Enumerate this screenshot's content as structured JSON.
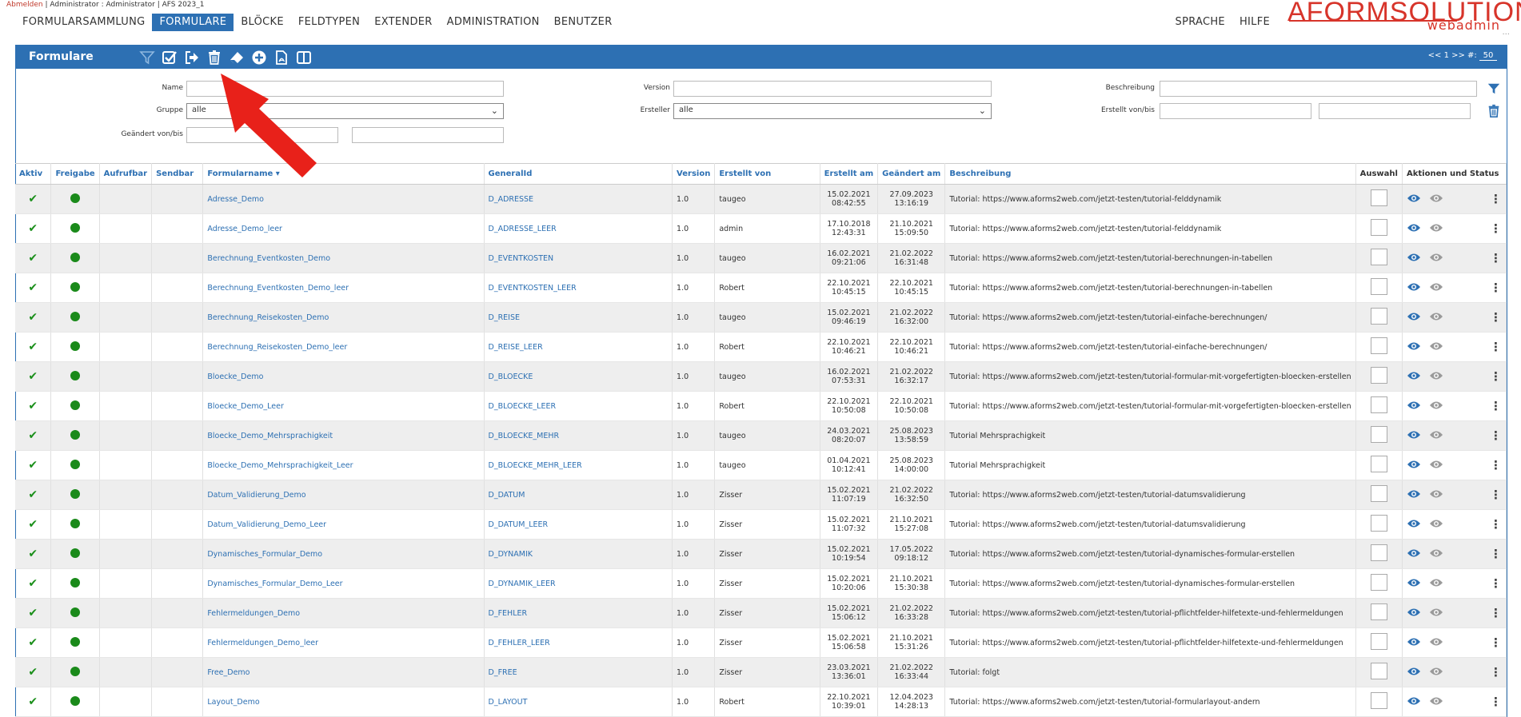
{
  "topline": {
    "logout": "Abmelden",
    "info": " | Administrator : Administrator | AFS 2023_1"
  },
  "nav": {
    "items": [
      "FORMULARSAMMLUNG",
      "FORMULARE",
      "BLÖCKE",
      "FELDTYPEN",
      "EXTENDER",
      "ADMINISTRATION",
      "BENUTZER"
    ],
    "active": "FORMULARE",
    "right": [
      "SPRACHE",
      "HILFE"
    ]
  },
  "logo": {
    "main": "AFORMSOLUTION",
    "sub": "webadmin"
  },
  "panel": {
    "title": "Formulare",
    "pager_text": "<< 1 >>  #:",
    "page_size": "50"
  },
  "toolbar_icons": [
    "filter-icon",
    "check-all-icon",
    "export-icon",
    "delete-icon",
    "eraser-icon",
    "add-icon",
    "pdf-icon",
    "columns-icon"
  ],
  "filters": {
    "name_label": "Name",
    "version_label": "Version",
    "beschreibung_label": "Beschreibung",
    "gruppe_label": "Gruppe",
    "gruppe_value": "alle",
    "ersteller_label": "Ersteller",
    "ersteller_value": "alle",
    "erstellt_label": "Erstellt von/bis",
    "geaendert_label": "Geändert von/bis"
  },
  "table": {
    "headers": {
      "aktiv": "Aktiv",
      "freigabe": "Freigabe",
      "aufrufbar": "Aufrufbar",
      "sendbar": "Sendbar",
      "formularname": "Formularname ▾",
      "generalid": "GeneralId",
      "version": "Version",
      "erstellt_von": "Erstellt von",
      "erstellt_am": "Erstellt am",
      "geaendert_am": "Geändert am",
      "beschreibung": "Beschreibung",
      "auswahl": "Auswahl",
      "aktionen": "Aktionen und Status"
    },
    "rows": [
      {
        "name": "Adresse_Demo",
        "gid": "D_ADRESSE",
        "ver": "1.0",
        "von": "taugeo",
        "ed": "15.02.2021",
        "et": "08:42:55",
        "gd": "27.09.2023",
        "gt": "13:16:19",
        "desc": "Tutorial: https://www.aforms2web.com/jetzt-testen/tutorial-felddynamik"
      },
      {
        "name": "Adresse_Demo_leer",
        "gid": "D_ADRESSE_LEER",
        "ver": "1.0",
        "von": "admin",
        "ed": "17.10.2018",
        "et": "12:43:31",
        "gd": "21.10.2021",
        "gt": "15:09:50",
        "desc": "Tutorial: https://www.aforms2web.com/jetzt-testen/tutorial-felddynamik"
      },
      {
        "name": "Berechnung_Eventkosten_Demo",
        "gid": "D_EVENTKOSTEN",
        "ver": "1.0",
        "von": "taugeo",
        "ed": "16.02.2021",
        "et": "09:21:06",
        "gd": "21.02.2022",
        "gt": "16:31:48",
        "desc": "Tutorial: https://www.aforms2web.com/jetzt-testen/tutorial-berechnungen-in-tabellen"
      },
      {
        "name": "Berechnung_Eventkosten_Demo_leer",
        "gid": "D_EVENTKOSTEN_LEER",
        "ver": "1.0",
        "von": "Robert",
        "ed": "22.10.2021",
        "et": "10:45:15",
        "gd": "22.10.2021",
        "gt": "10:45:15",
        "desc": "Tutorial: https://www.aforms2web.com/jetzt-testen/tutorial-berechnungen-in-tabellen"
      },
      {
        "name": "Berechnung_Reisekosten_Demo",
        "gid": "D_REISE",
        "ver": "1.0",
        "von": "taugeo",
        "ed": "15.02.2021",
        "et": "09:46:19",
        "gd": "21.02.2022",
        "gt": "16:32:00",
        "desc": "Tutorial: https://www.aforms2web.com/jetzt-testen/tutorial-einfache-berechnungen/"
      },
      {
        "name": "Berechnung_Reisekosten_Demo_leer",
        "gid": "D_REISE_LEER",
        "ver": "1.0",
        "von": "Robert",
        "ed": "22.10.2021",
        "et": "10:46:21",
        "gd": "22.10.2021",
        "gt": "10:46:21",
        "desc": "Tutorial: https://www.aforms2web.com/jetzt-testen/tutorial-einfache-berechnungen/"
      },
      {
        "name": "Bloecke_Demo",
        "gid": "D_BLOECKE",
        "ver": "1.0",
        "von": "taugeo",
        "ed": "16.02.2021",
        "et": "07:53:31",
        "gd": "21.02.2022",
        "gt": "16:32:17",
        "desc": "Tutorial: https://www.aforms2web.com/jetzt-testen/tutorial-formular-mit-vorgefertigten-bloecken-erstellen"
      },
      {
        "name": "Bloecke_Demo_Leer",
        "gid": "D_BLOECKE_LEER",
        "ver": "1.0",
        "von": "Robert",
        "ed": "22.10.2021",
        "et": "10:50:08",
        "gd": "22.10.2021",
        "gt": "10:50:08",
        "desc": "Tutorial: https://www.aforms2web.com/jetzt-testen/tutorial-formular-mit-vorgefertigten-bloecken-erstellen"
      },
      {
        "name": "Bloecke_Demo_Mehrsprachigkeit",
        "gid": "D_BLOECKE_MEHR",
        "ver": "1.0",
        "von": "taugeo",
        "ed": "24.03.2021",
        "et": "08:20:07",
        "gd": "25.08.2023",
        "gt": "13:58:59",
        "desc": "Tutorial Mehrsprachigkeit"
      },
      {
        "name": "Bloecke_Demo_Mehrsprachigkeit_Leer",
        "gid": "D_BLOECKE_MEHR_LEER",
        "ver": "1.0",
        "von": "taugeo",
        "ed": "01.04.2021",
        "et": "10:12:41",
        "gd": "25.08.2023",
        "gt": "14:00:00",
        "desc": "Tutorial Mehrsprachigkeit"
      },
      {
        "name": "Datum_Validierung_Demo",
        "gid": "D_DATUM",
        "ver": "1.0",
        "von": "Zisser",
        "ed": "15.02.2021",
        "et": "11:07:19",
        "gd": "21.02.2022",
        "gt": "16:32:50",
        "desc": "Tutorial: https://www.aforms2web.com/jetzt-testen/tutorial-datumsvalidierung"
      },
      {
        "name": "Datum_Validierung_Demo_Leer",
        "gid": "D_DATUM_LEER",
        "ver": "1.0",
        "von": "Zisser",
        "ed": "15.02.2021",
        "et": "11:07:32",
        "gd": "21.10.2021",
        "gt": "15:27:08",
        "desc": "Tutorial: https://www.aforms2web.com/jetzt-testen/tutorial-datumsvalidierung"
      },
      {
        "name": "Dynamisches_Formular_Demo",
        "gid": "D_DYNAMIK",
        "ver": "1.0",
        "von": "Zisser",
        "ed": "15.02.2021",
        "et": "10:19:54",
        "gd": "17.05.2022",
        "gt": "09:18:12",
        "desc": "Tutorial: https://www.aforms2web.com/jetzt-testen/tutorial-dynamisches-formular-erstellen"
      },
      {
        "name": "Dynamisches_Formular_Demo_Leer",
        "gid": "D_DYNAMIK_LEER",
        "ver": "1.0",
        "von": "Zisser",
        "ed": "15.02.2021",
        "et": "10:20:06",
        "gd": "21.10.2021",
        "gt": "15:30:38",
        "desc": "Tutorial: https://www.aforms2web.com/jetzt-testen/tutorial-dynamisches-formular-erstellen"
      },
      {
        "name": "Fehlermeldungen_Demo",
        "gid": "D_FEHLER",
        "ver": "1.0",
        "von": "Zisser",
        "ed": "15.02.2021",
        "et": "15:06:12",
        "gd": "21.02.2022",
        "gt": "16:33:28",
        "desc": "Tutorial: https://www.aforms2web.com/jetzt-testen/tutorial-pflichtfelder-hilfetexte-und-fehlermeldungen"
      },
      {
        "name": "Fehlermeldungen_Demo_leer",
        "gid": "D_FEHLER_LEER",
        "ver": "1.0",
        "von": "Zisser",
        "ed": "15.02.2021",
        "et": "15:06:58",
        "gd": "21.10.2021",
        "gt": "15:31:26",
        "desc": "Tutorial: https://www.aforms2web.com/jetzt-testen/tutorial-pflichtfelder-hilfetexte-und-fehlermeldungen"
      },
      {
        "name": "Free_Demo",
        "gid": "D_FREE",
        "ver": "1.0",
        "von": "Zisser",
        "ed": "23.03.2021",
        "et": "13:36:01",
        "gd": "21.02.2022",
        "gt": "16:33:44",
        "desc": "Tutorial: folgt"
      },
      {
        "name": "Layout_Demo",
        "gid": "D_LAYOUT",
        "ver": "1.0",
        "von": "Robert",
        "ed": "22.10.2021",
        "et": "10:39:01",
        "gd": "12.04.2023",
        "gt": "14:28:13",
        "desc": "Tutorial: https://www.aforms2web.com/jetzt-testen/tutorial-formularlayout-andern"
      }
    ]
  },
  "colors": {
    "accent": "#2d70b3",
    "active_green": "#1a8a1a",
    "annotation_red": "#e8211a"
  }
}
